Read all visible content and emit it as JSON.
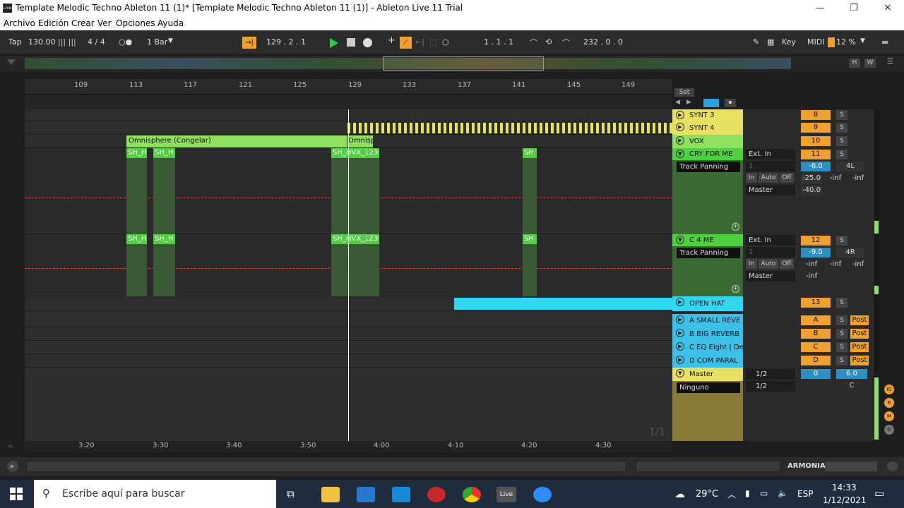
{
  "window": {
    "title": "Template Melodic Techno Ableton 11 (1)*  [Template Melodic Techno Ableton 11 (1)] - Ableton Live 11 Trial",
    "icon_text": "Live"
  },
  "menu": [
    "Archivo",
    "Edición",
    "Crear",
    "Ver",
    "Opciones",
    "Ayuda"
  ],
  "toolbar": {
    "tap": "Tap",
    "tempo": "130.00",
    "signature": "4 / 4",
    "quantize": "1 Bar",
    "position": "129 .  2 .  1",
    "loop_start": "1 .  1 .  1",
    "loop_len": "232 .  0 .  0",
    "key": "Key",
    "midi": "MIDI",
    "cpu": "12 %"
  },
  "ruler": {
    "bars": [
      "109",
      "113",
      "117",
      "121",
      "125",
      "129",
      "133",
      "137",
      "141",
      "145",
      "149"
    ],
    "set_label": "Set"
  },
  "time_ruler": [
    "3:20",
    "3:30",
    "3:40",
    "3:50",
    "4:00",
    "4:10",
    "4:20",
    "4:30"
  ],
  "page_counter": "1/1",
  "clips": {
    "omni": "Omnisphere (Congelar)",
    "omni2": "Omnisp",
    "sh1": "SH_H",
    "sh2": "SH_H",
    "shvx": "SH_HVX_123!",
    "sh4": "SH"
  },
  "tracks": [
    {
      "name": "SYNT 3",
      "num": "8",
      "color": "#e8e060"
    },
    {
      "name": "SYNT 4",
      "num": "9",
      "color": "#e8e060"
    },
    {
      "name": "VOX",
      "num": "10",
      "color": "#90e060"
    },
    {
      "name": "CRY FOR ME",
      "num": "11",
      "color": "#50d040"
    },
    {
      "name": "C 4 ME",
      "num": "12",
      "color": "#50d040"
    },
    {
      "name": "OPEN HAT",
      "num": "13",
      "color": "#2fd8f0"
    },
    {
      "name": "A SMALL REVE",
      "num": "A",
      "color": "#3cc0e8"
    },
    {
      "name": "B BIG REVERB",
      "num": "B",
      "color": "#3cc0e8"
    },
    {
      "name": "C EQ Eight | De",
      "num": "C",
      "color": "#3cc0e8"
    },
    {
      "name": "D COM PARAL",
      "num": "D",
      "color": "#3cc0e8"
    },
    {
      "name": "Master",
      "num": "0",
      "color": "#e8e060"
    }
  ],
  "cry": {
    "input": "Ext. In",
    "channel": "1",
    "track_panning": "Track Panning",
    "vol": "-6.0",
    "pan": "4L",
    "in": "In",
    "auto": "Auto",
    "off": "Off",
    "send1": "-25.0",
    "send2": "-inf",
    "send3": "-inf",
    "out": "Master",
    "send4": "-40.0"
  },
  "c4me": {
    "input": "Ext. In",
    "channel": "1",
    "track_panning": "Track Panning",
    "vol": "-9.0",
    "pan": "4R",
    "in": "In",
    "auto": "Auto",
    "off": "Off",
    "send1": "-inf",
    "send2": "-inf",
    "send3": "-inf",
    "out": "Master",
    "send4": "-inf"
  },
  "master": {
    "none": "Ninguno",
    "out1": "1/2",
    "out2": "1/2",
    "vol": "6.0",
    "pan": "C"
  },
  "s_label": "S",
  "post_label": "Post",
  "statusbar": {
    "armonia": "ARMONIA"
  },
  "taskbar": {
    "search": "Escribe aquí para buscar",
    "temp": "29°C",
    "lang": "ESP",
    "time": "14:33",
    "date": "1/12/2021"
  }
}
